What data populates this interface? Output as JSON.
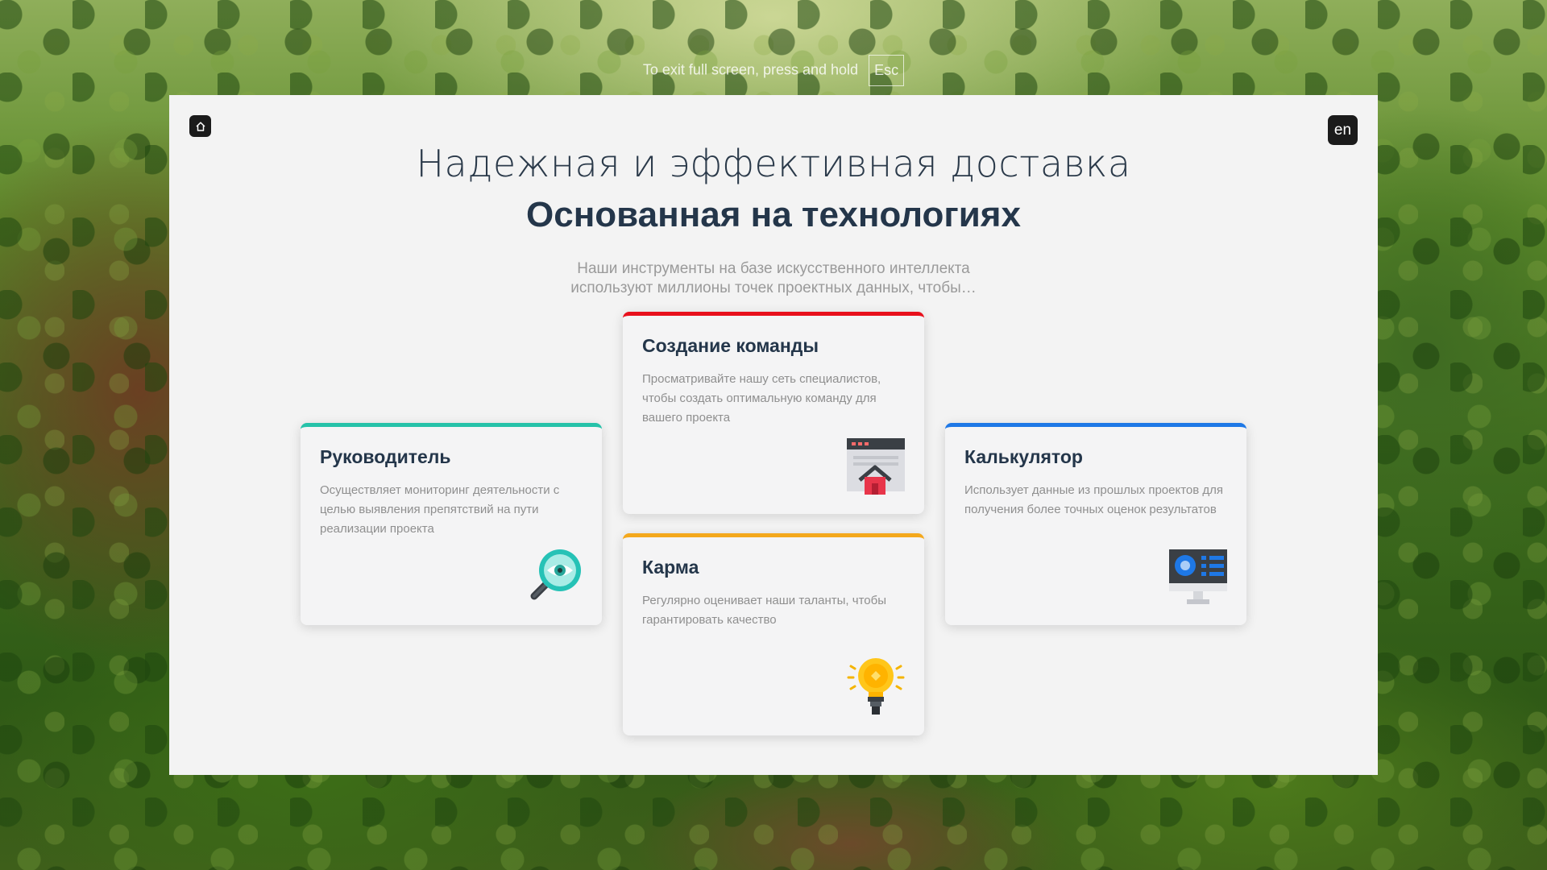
{
  "fullscreen_notice": {
    "text": "To exit full screen, press and hold",
    "key": "Esc"
  },
  "header": {
    "home_icon": "house-icon",
    "lang_label": "en",
    "title_light": "Надежная и эффективная доставка",
    "title_bold": "Основанная на технологиях",
    "subtitle_line1": "Наши инструменты на базе искусственного интеллекта",
    "subtitle_line2": "используют миллионы точек проектных данных, чтобы…"
  },
  "cards": {
    "lead": {
      "title": "Руководитель",
      "text": "Осуществляет мониторинг деятельности с целью выявления препятствий на пути реализации проекта",
      "icon": "magnifier-eye-icon",
      "accent": "#26c2a9"
    },
    "team": {
      "title": "Создание команды",
      "text": "Просматривайте нашу сеть специалистов, чтобы создать оптимальную команду для вашего проекта",
      "icon": "browser-home-icon",
      "accent": "#e8101c"
    },
    "karma": {
      "title": "Карма",
      "text": "Регулярно оценивает наши таланты, чтобы гарантировать качество",
      "icon": "lightbulb-icon",
      "accent": "#f4a81c"
    },
    "calc": {
      "title": "Калькулятор",
      "text": "Использует данные из прошлых проектов для получения более точных оценок результатов",
      "icon": "monitor-report-icon",
      "accent": "#1e78e6"
    }
  }
}
